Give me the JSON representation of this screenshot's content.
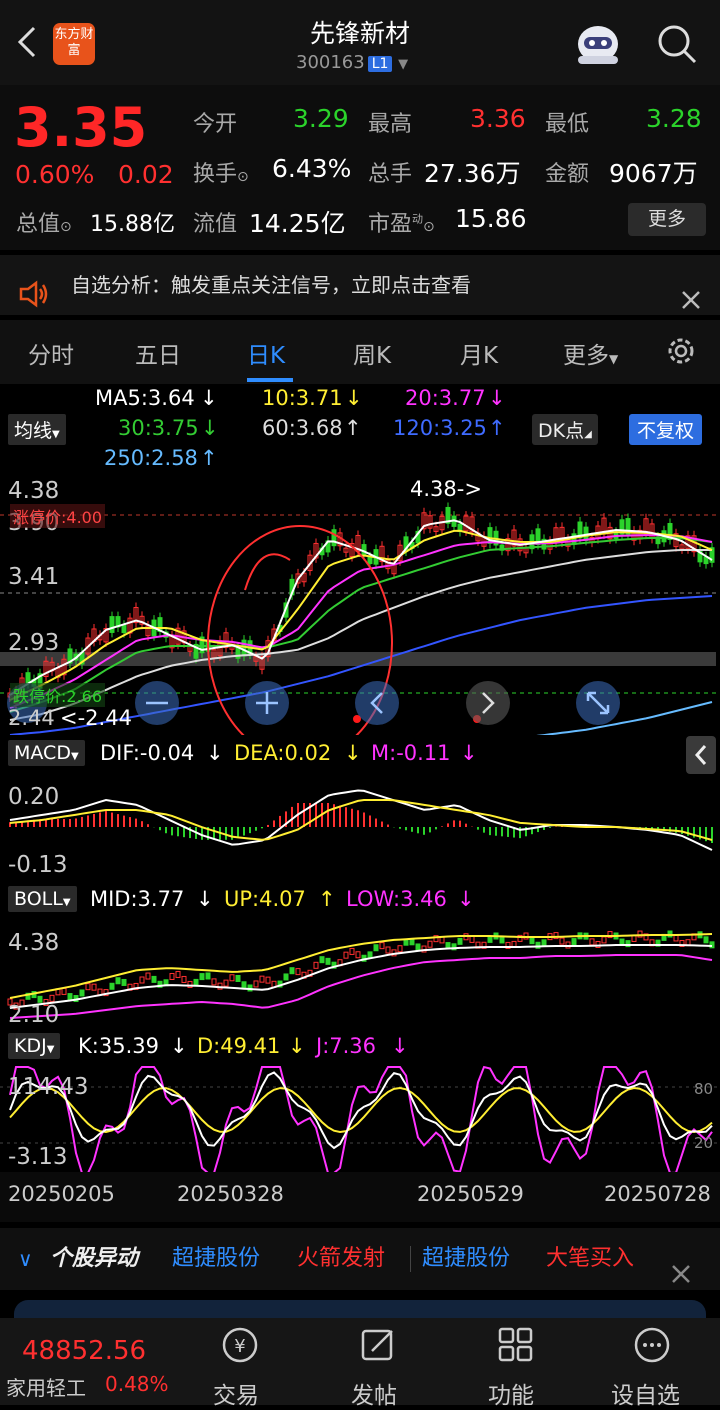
{
  "header": {
    "stock_name": "先锋新材",
    "stock_code": "300163",
    "level_badge": "L1",
    "brand_logo_text": "东方财富"
  },
  "quote": {
    "price": "3.35",
    "change_pct": "0.60%",
    "change_amt": "0.02",
    "open_label": "今开",
    "open": "3.29",
    "high_label": "最高",
    "high": "3.36",
    "low_label": "最低",
    "low": "3.28",
    "turnover_label": "换手",
    "turnover": "6.43%",
    "volume_label": "总手",
    "volume": "27.36万",
    "amount_label": "金额",
    "amount": "9067万",
    "mktcap_label": "总值",
    "mktcap": "15.88亿",
    "float_label": "流值",
    "float_val": "14.25亿",
    "pe_label": "市盈",
    "pe_sup": "动",
    "pe": "15.86",
    "more_button": "更多"
  },
  "notice": {
    "text": "自选分析：触发重点关注信号，立即点击查看"
  },
  "tabs": [
    "分时",
    "五日",
    "日K",
    "周K",
    "月K",
    "更多"
  ],
  "active_tab": "日K",
  "ma_panel": {
    "selector": "均线",
    "ma5": "MA5:3.64",
    "ma10": "10:3.71",
    "ma20": "20:3.77",
    "ma30": "30:3.75",
    "ma60": "60:3.68",
    "ma120": "120:3.25",
    "ma250": "250:2.58",
    "dk_button": "DK点",
    "fq_button": "不复权"
  },
  "kline_axis": {
    "y_top": "4.38",
    "y2": "3.90",
    "y3": "3.41",
    "y4": "2.93",
    "limit_up": "涨停价:4.00",
    "limit_down": "跌停价:2.66",
    "max_label": "4.38->",
    "min_label": "<-2.44",
    "y_low_partial": "2.44"
  },
  "macd": {
    "selector": "MACD",
    "dif": "DIF:-0.04",
    "dea": "DEA:0.02",
    "m": "M:-0.11",
    "y_top": "0.20",
    "y_bottom": "-0.13"
  },
  "boll": {
    "selector": "BOLL",
    "mid": "MID:3.77",
    "up": "UP:4.07",
    "low": "LOW:3.46",
    "y_top": "4.38",
    "y_bottom": "2.10"
  },
  "kdj": {
    "selector": "KDJ",
    "k": "K:35.39",
    "d": "D:49.41",
    "j": "J:7.36",
    "y_top": "114.43",
    "y_bottom": "-3.13",
    "ref80": "80",
    "ref20": "20"
  },
  "dates": [
    "20250205",
    "20250328",
    "20250529",
    "20250728"
  ],
  "news": {
    "title": "个股异动",
    "items": [
      "超捷股份",
      "火箭发射",
      "超捷股份",
      "大笔买入"
    ]
  },
  "bottom_bar": {
    "index_value": "48852.56",
    "index_name": "家用轻工",
    "index_change": "0.48%",
    "nav": [
      "交易",
      "发帖",
      "功能",
      "设自选"
    ]
  },
  "colors": {
    "up": "#ff3030",
    "down": "#2bd32b",
    "accent": "#2f8dff",
    "ma5": "#ffffff",
    "ma10": "#ffee33",
    "ma20": "#ff33ff",
    "ma30": "#33cc33",
    "ma60": "#dddddd",
    "ma120": "#3355ff",
    "ma250": "#66bbff"
  }
}
